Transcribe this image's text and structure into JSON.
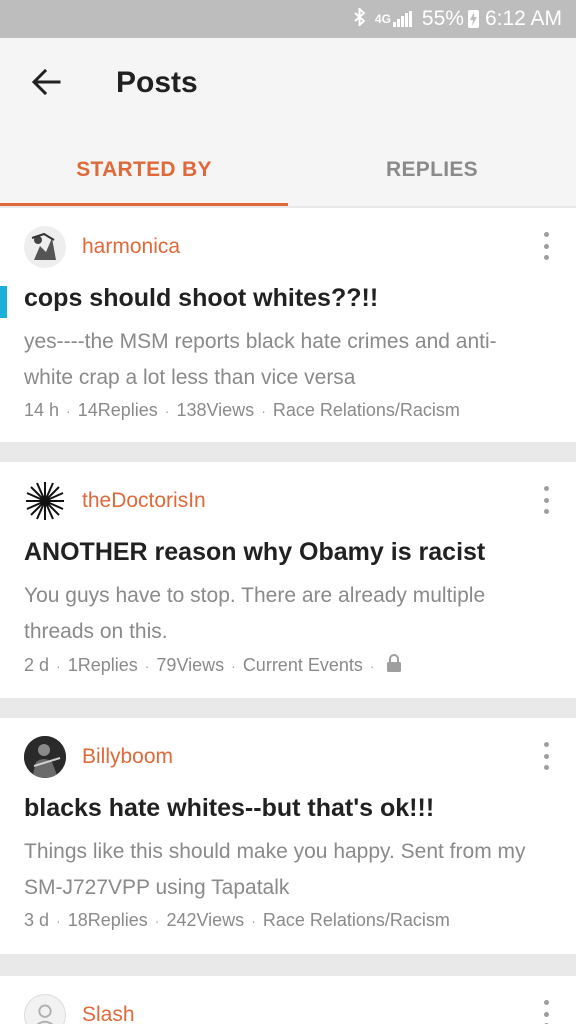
{
  "status_bar": {
    "network": "4G",
    "battery": "55%",
    "time": "6:12 AM"
  },
  "header": {
    "title": "Posts",
    "tabs": [
      {
        "label": "STARTED BY",
        "active": true
      },
      {
        "label": "REPLIES",
        "active": false
      }
    ]
  },
  "colors": {
    "accent": "#e0693a",
    "unread": "#1ab0d8"
  },
  "posts": [
    {
      "username": "harmonica",
      "avatar_icon": "harmonica-avatar",
      "title": "cops should shoot whites??!!",
      "excerpt": "yes----the MSM reports black hate crimes and anti-white crap a lot less than vice versa",
      "age": "14 h",
      "replies": "14Replies",
      "views": "138Views",
      "forum": "Race Relations/Racism",
      "unread": true,
      "locked": false
    },
    {
      "username": "theDoctorisIn",
      "avatar_icon": "starburst-avatar",
      "title": "ANOTHER reason why Obamy is racist",
      "excerpt": "You guys have to stop. There are already multiple threads on this.",
      "age": "2 d",
      "replies": "1Replies",
      "views": "79Views",
      "forum": "Current Events",
      "unread": false,
      "locked": true
    },
    {
      "username": "Billyboom",
      "avatar_icon": "photo-avatar",
      "title": "blacks hate whites--but that's ok!!!",
      "excerpt": "Things like this should make you happy. Sent from my SM-J727VPP using Tapatalk",
      "age": "3 d",
      "replies": "18Replies",
      "views": "242Views",
      "forum": "Race Relations/Racism",
      "unread": false,
      "locked": false
    },
    {
      "username": "Slash",
      "avatar_icon": "default-user-avatar"
    }
  ]
}
